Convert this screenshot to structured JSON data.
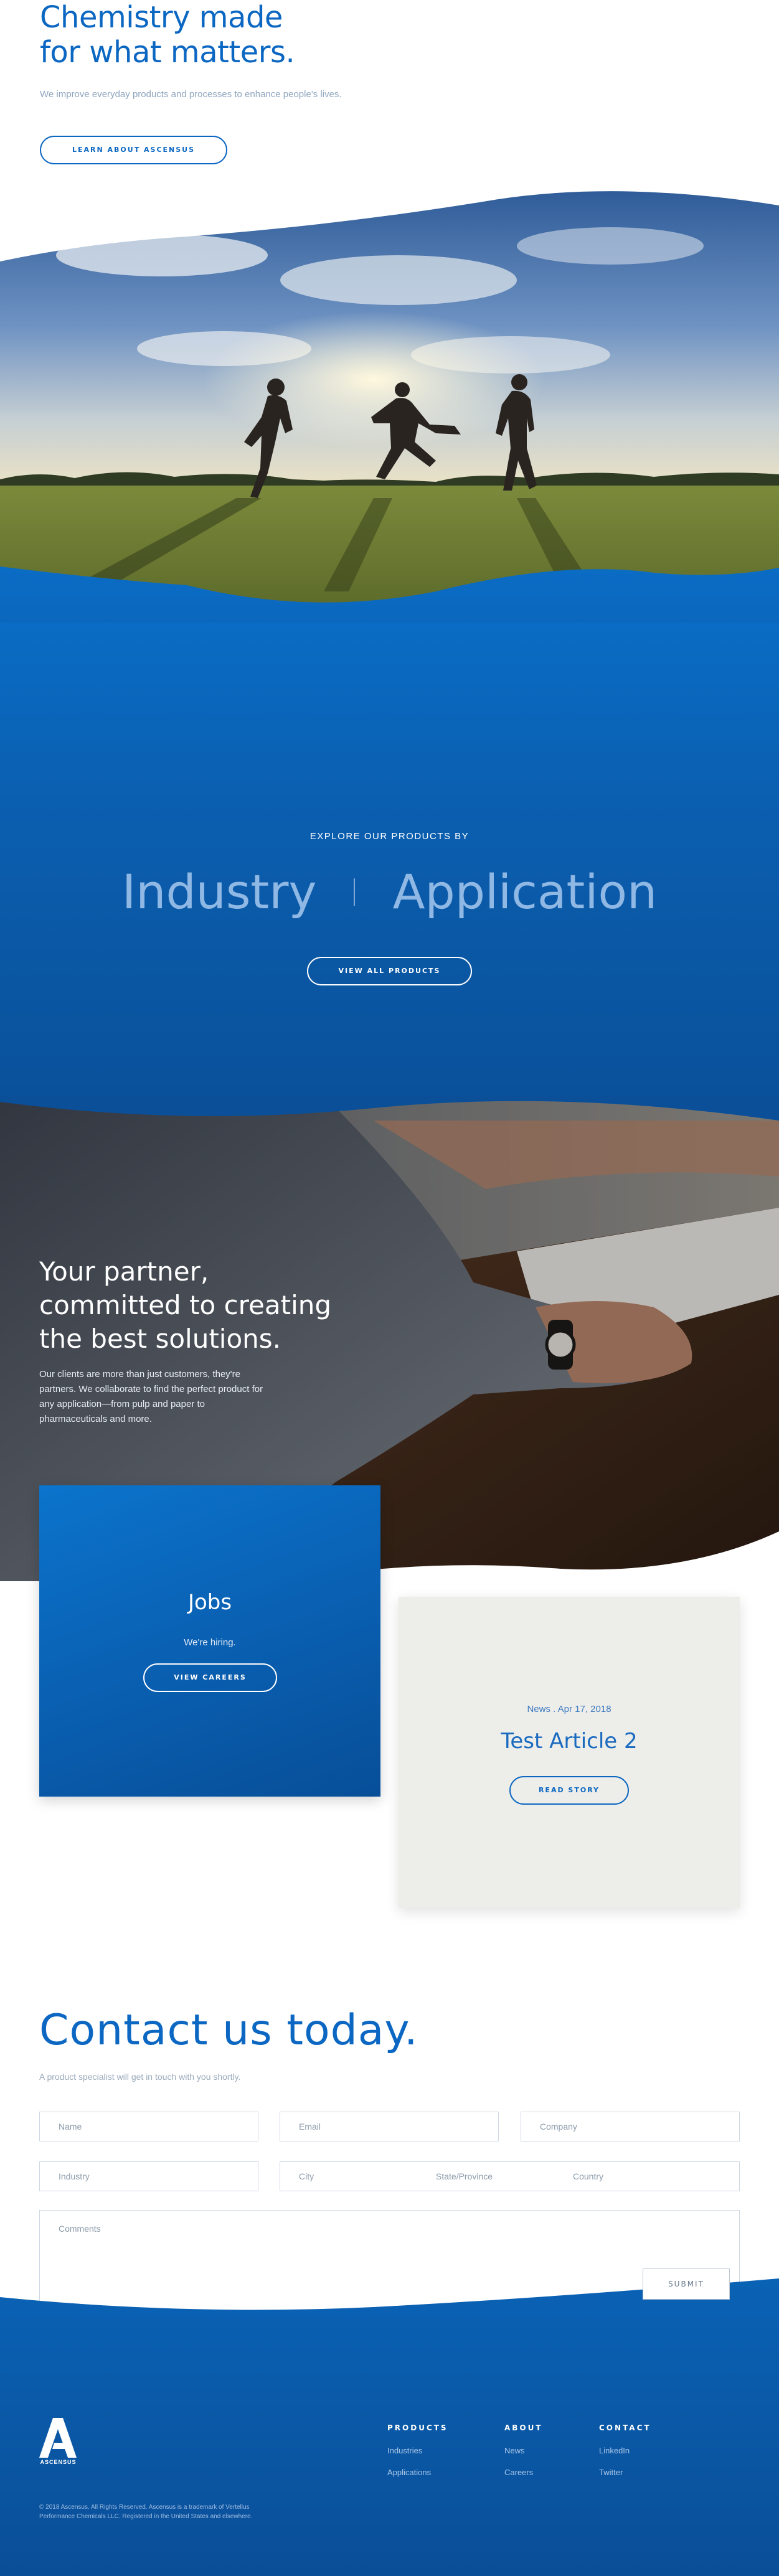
{
  "hero": {
    "title_line1": "Chemistry made",
    "title_line2": "for what matters.",
    "subtitle": "We improve everyday products and processes to enhance people's lives.",
    "cta": "LEARN ABOUT ASCENSUS"
  },
  "products": {
    "label": "EXPLORE OUR PRODUCTS BY",
    "categories": [
      "Industry",
      "Application"
    ],
    "cta": "VIEW ALL PRODUCTS"
  },
  "partner": {
    "title_line1": "Your partner,",
    "title_line2": "committed to creating",
    "title_line3": "the best solutions.",
    "text": "Our clients are more than just customers, they're partners. We collaborate to find the perfect product for any application—from pulp and paper to pharmaceuticals and more."
  },
  "jobs_card": {
    "title": "Jobs",
    "text": "We're hiring.",
    "cta": "VIEW CAREERS"
  },
  "news_card": {
    "meta": "News . Apr 17, 2018",
    "title": "Test Article 2",
    "cta": "READ STORY"
  },
  "contact": {
    "title": "Contact us today.",
    "subtitle": "A product specialist will get in touch with you shortly.",
    "placeholders": {
      "name": "Name",
      "email": "Email",
      "company": "Company",
      "industry": "Industry",
      "city": "City",
      "state": "State/Province",
      "country": "Country",
      "comments": "Comments"
    },
    "submit": "SUBMIT"
  },
  "footer": {
    "logo_text": "ASCENSUS",
    "columns": [
      {
        "heading": "PRODUCTS",
        "links": [
          "Industries",
          "Applications"
        ]
      },
      {
        "heading": "ABOUT",
        "links": [
          "News",
          "Careers"
        ]
      },
      {
        "heading": "CONTACT",
        "links": [
          "LinkedIn",
          "Twitter"
        ]
      }
    ],
    "copyright": "© 2018 Ascensus. All Rights Reserved. Ascensus is a trademark of Vertellus Performance Chemicals LLC. Registered in the United States and elsewhere."
  },
  "colors": {
    "brand_blue": "#0b67c2",
    "deep_blue": "#0a4f98",
    "light_text": "#8fa6bf",
    "card_gray": "#ededea"
  }
}
